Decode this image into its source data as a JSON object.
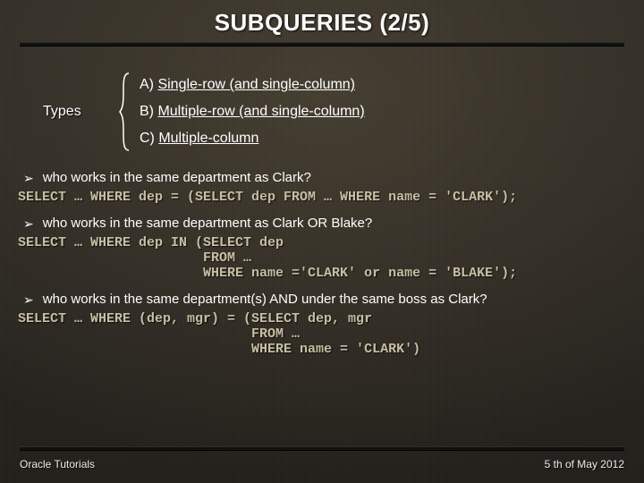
{
  "title": "SUBQUERIES (2/5)",
  "types_label": "Types",
  "types": [
    {
      "prefix": "A) ",
      "text": "Single-row (and single-column)"
    },
    {
      "prefix": "B) ",
      "text": "Multiple-row (and single-column)"
    },
    {
      "prefix": "C) ",
      "text": "Multiple-column"
    }
  ],
  "bullets": [
    "who works in the same department as Clark?",
    "who works in the same department as Clark OR Blake?",
    "who works in the same department(s) AND under the same boss as Clark?"
  ],
  "code": [
    "SELECT … WHERE dep = (SELECT dep FROM … WHERE name = 'CLARK');",
    "SELECT … WHERE dep IN (SELECT dep\n                       FROM …\n                       WHERE name ='CLARK' or name = 'BLAKE');",
    "SELECT … WHERE (dep, mgr) = (SELECT dep, mgr\n                             FROM …\n                             WHERE name = 'CLARK')"
  ],
  "footer": {
    "left": "Oracle Tutorials",
    "right": "5 th of May 2012"
  },
  "colors": {
    "code": "#c8bfa3"
  }
}
